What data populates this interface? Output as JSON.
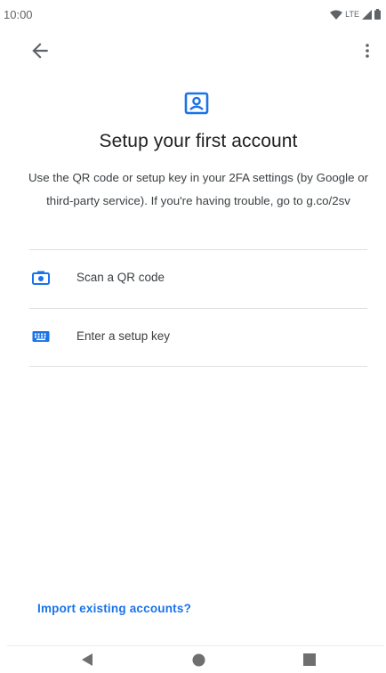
{
  "status_bar": {
    "time": "10:00",
    "network": "LTE",
    "icons": [
      "wifi-icon",
      "signal-icon",
      "battery-icon"
    ]
  },
  "toolbar": {
    "back_icon": "arrow-back-icon",
    "menu_icon": "more-vert-icon"
  },
  "header": {
    "icon": "account-box-icon",
    "title": "Setup your first account",
    "description": "Use the QR code or setup key in your 2FA settings (by Google or third-party service). If you're having trouble, go to g.co/2sv"
  },
  "options": [
    {
      "label": "Scan a QR code",
      "icon": "camera-icon"
    },
    {
      "label": "Enter a setup key",
      "icon": "keyboard-icon"
    }
  ],
  "footer": {
    "import_link": "Import existing accounts?"
  },
  "nav_bar": {
    "icons": [
      "back-triangle-icon",
      "home-circle-icon",
      "recents-square-icon"
    ]
  },
  "colors": {
    "accent": "#1a73e8",
    "text_primary": "#202124",
    "text_secondary": "#3c4043",
    "divider": "#e0e0e0",
    "nav_icons": "#6f6f6f"
  }
}
